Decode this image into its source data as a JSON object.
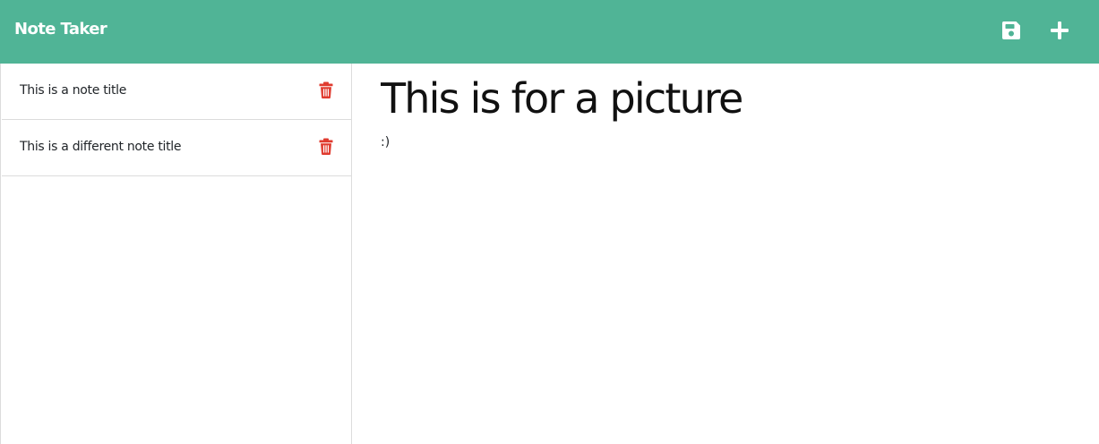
{
  "header": {
    "brand": "Note Taker",
    "background_color": "#50b496",
    "icons": [
      "save-icon",
      "plus-icon"
    ]
  },
  "sidebar": {
    "notes": [
      {
        "title": "This is a note title",
        "delete_icon": "trash-icon"
      },
      {
        "title": "This is a different note title",
        "delete_icon": "trash-icon"
      }
    ],
    "delete_icon_color": "#e03b2f"
  },
  "editor": {
    "note_title": "This is for a picture",
    "note_text": ":)"
  }
}
